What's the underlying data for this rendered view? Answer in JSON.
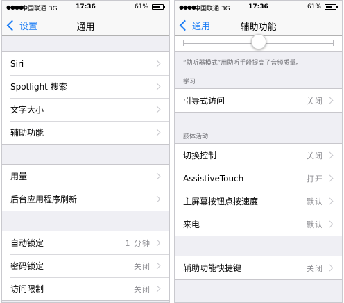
{
  "status": {
    "carrier": "中国联通",
    "network": "3G",
    "time": "17:36",
    "battery": "61%"
  },
  "left": {
    "back_label": "设置",
    "title": "通用",
    "group1": [
      {
        "label": "Siri"
      },
      {
        "label": "Spotlight 搜索"
      },
      {
        "label": "文字大小"
      },
      {
        "label": "辅助功能"
      }
    ],
    "group2": [
      {
        "label": "用量"
      },
      {
        "label": "后台应用程序刷新"
      }
    ],
    "group3": [
      {
        "label": "自动锁定",
        "value": "1 分钟"
      },
      {
        "label": "密码锁定",
        "value": "关闭"
      },
      {
        "label": "访问限制",
        "value": "关闭"
      }
    ]
  },
  "right": {
    "back_label": "通用",
    "title": "辅助功能",
    "slider_value": 0.5,
    "hearing_note": "“助听器模式”用助听手段提高了音频质量。",
    "learning_header": "学习",
    "guided_access": {
      "label": "引导式访问",
      "value": "关闭"
    },
    "physical_header": "肢体活动",
    "physical": [
      {
        "label": "切换控制",
        "value": "关闭"
      },
      {
        "label": "AssistiveTouch",
        "value": "打开"
      },
      {
        "label": "主屏幕按钮点按速度",
        "value": "默认"
      },
      {
        "label": "来电",
        "value": "默认"
      }
    ],
    "shortcut": {
      "label": "辅助功能快捷键",
      "value": "关闭"
    }
  },
  "colors": {
    "accent": "#1a7cf5",
    "background": "#efeff4",
    "secondary_text": "#8e8e93"
  }
}
